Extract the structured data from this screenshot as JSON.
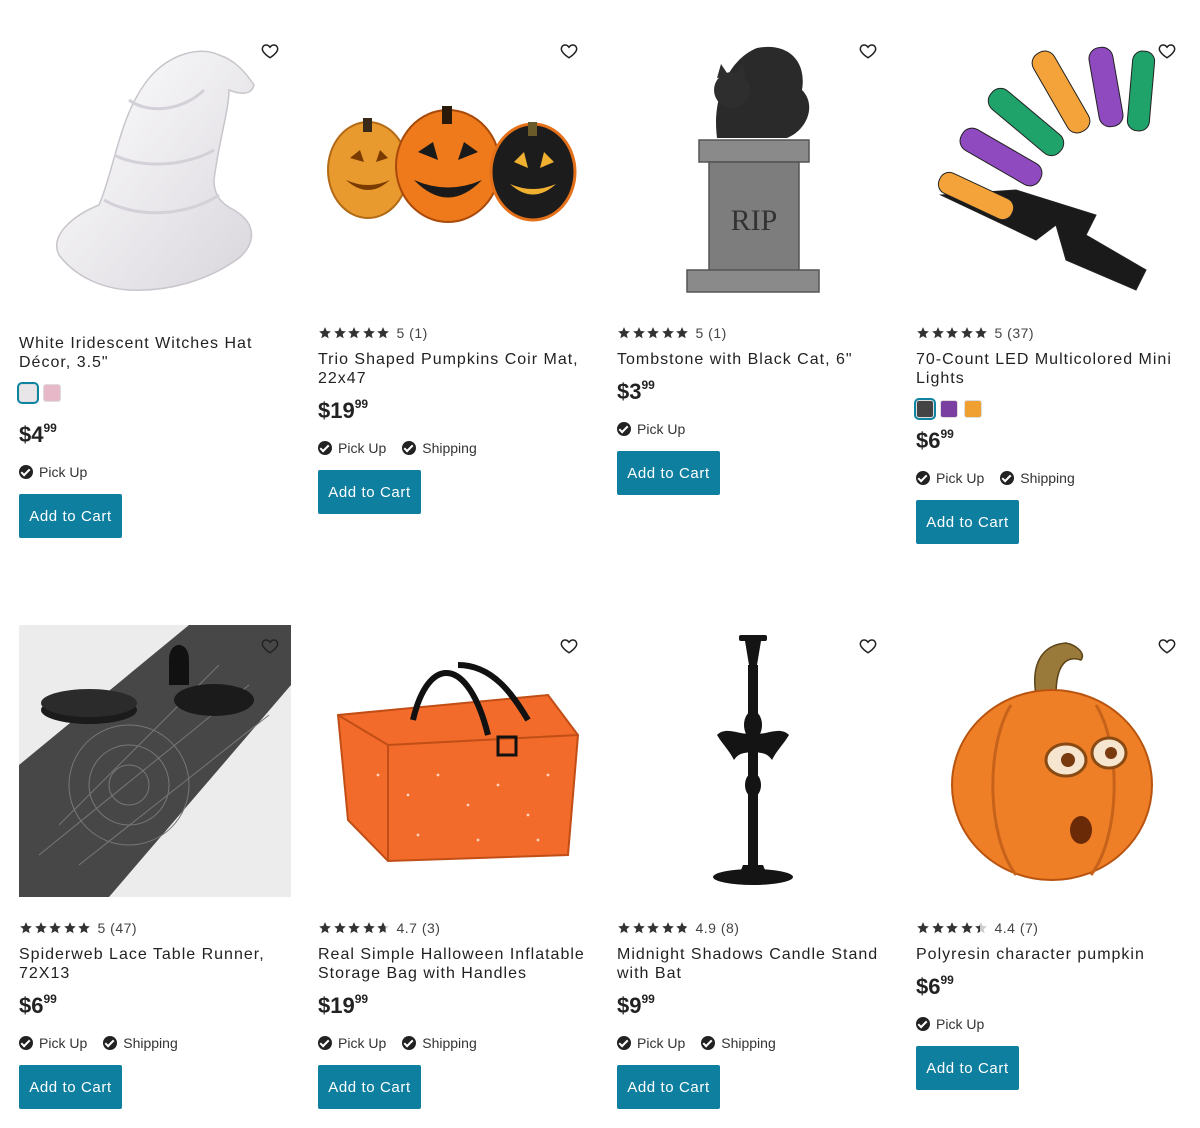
{
  "products": [
    {
      "title": "White Iridescent Witches Hat Décor, 3.5\"",
      "rating": null,
      "rating_text": "",
      "swatches": [
        {
          "color": "#e9e6ea",
          "selected": true
        },
        {
          "color": "#e7b9c8",
          "selected": false
        }
      ],
      "price": {
        "currency": "$",
        "whole": "4",
        "cents": "99"
      },
      "fulfillment": [
        "Pick Up"
      ],
      "button_label": "Add to Cart",
      "image_icon": "witch-hat-icon"
    },
    {
      "title": "Trio Shaped Pumpkins Coir Mat, 22x47",
      "rating": 5,
      "rating_text": "5 (1)",
      "swatches": [],
      "price": {
        "currency": "$",
        "whole": "19",
        "cents": "99"
      },
      "fulfillment": [
        "Pick Up",
        "Shipping"
      ],
      "button_label": "Add to Cart",
      "image_icon": "pumpkin-mat-icon"
    },
    {
      "title": "Tombstone with Black Cat, 6\"",
      "rating": 5,
      "rating_text": "5 (1)",
      "swatches": [],
      "price": {
        "currency": "$",
        "whole": "3",
        "cents": "99"
      },
      "fulfillment": [
        "Pick Up"
      ],
      "button_label": "Add to Cart",
      "image_icon": "tombstone-cat-icon"
    },
    {
      "title": "70-Count LED Multicolored Mini Lights",
      "rating": 5,
      "rating_text": "5 (37)",
      "swatches": [
        {
          "color": "#444444",
          "selected": true
        },
        {
          "color": "#7a3fa0",
          "selected": false
        },
        {
          "color": "#f0a030",
          "selected": false
        }
      ],
      "price": {
        "currency": "$",
        "whole": "6",
        "cents": "99"
      },
      "fulfillment": [
        "Pick Up",
        "Shipping"
      ],
      "button_label": "Add to Cart",
      "image_icon": "led-lights-icon"
    },
    {
      "title": "Spiderweb Lace Table Runner, 72X13",
      "rating": 5,
      "rating_text": "5 (47)",
      "swatches": [],
      "price": {
        "currency": "$",
        "whole": "6",
        "cents": "99"
      },
      "fulfillment": [
        "Pick Up",
        "Shipping"
      ],
      "button_label": "Add to Cart",
      "image_icon": "table-runner-icon"
    },
    {
      "title": "Real Simple Halloween Inflatable Storage Bag with Handles",
      "rating": 4.7,
      "rating_text": "4.7 (3)",
      "swatches": [],
      "price": {
        "currency": "$",
        "whole": "19",
        "cents": "99"
      },
      "fulfillment": [
        "Pick Up",
        "Shipping"
      ],
      "button_label": "Add to Cart",
      "image_icon": "storage-bag-icon"
    },
    {
      "title": "Midnight Shadows Candle Stand with Bat",
      "rating": 4.9,
      "rating_text": "4.9 (8)",
      "swatches": [],
      "price": {
        "currency": "$",
        "whole": "9",
        "cents": "99"
      },
      "fulfillment": [
        "Pick Up",
        "Shipping"
      ],
      "button_label": "Add to Cart",
      "image_icon": "candle-stand-icon"
    },
    {
      "title": "Polyresin character pumpkin",
      "rating": 4.4,
      "rating_text": "4.4 (7)",
      "swatches": [],
      "price": {
        "currency": "$",
        "whole": "6",
        "cents": "99"
      },
      "fulfillment": [
        "Pick Up"
      ],
      "button_label": "Add to Cart",
      "image_icon": "character-pumpkin-icon"
    }
  ],
  "colors": {
    "accent": "#0f7fa0",
    "text": "#222222"
  }
}
